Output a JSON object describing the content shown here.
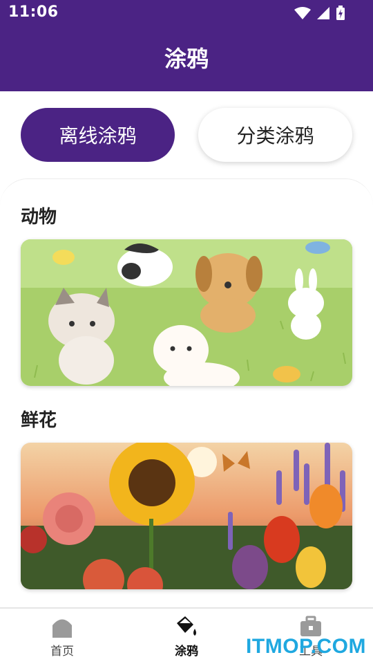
{
  "status_bar": {
    "time": "11:06"
  },
  "header": {
    "title": "涂鸦"
  },
  "tabs": [
    {
      "label": "离线涂鸦",
      "active": true
    },
    {
      "label": "分类涂鸦",
      "active": false
    }
  ],
  "sections": [
    {
      "title": "动物",
      "image": "animals-doodle-illustration"
    },
    {
      "title": "鲜花",
      "image": "flowers-painting-illustration"
    }
  ],
  "bottom_nav": [
    {
      "label": "首页",
      "icon": "home-icon",
      "active": false
    },
    {
      "label": "涂鸦",
      "icon": "paint-bucket-icon",
      "active": true
    },
    {
      "label": "工具",
      "icon": "toolbox-icon",
      "active": false
    }
  ],
  "watermark": "ITMOP.COM",
  "colors": {
    "primary": "#4b2384",
    "watermark": "#1fa8e0"
  }
}
